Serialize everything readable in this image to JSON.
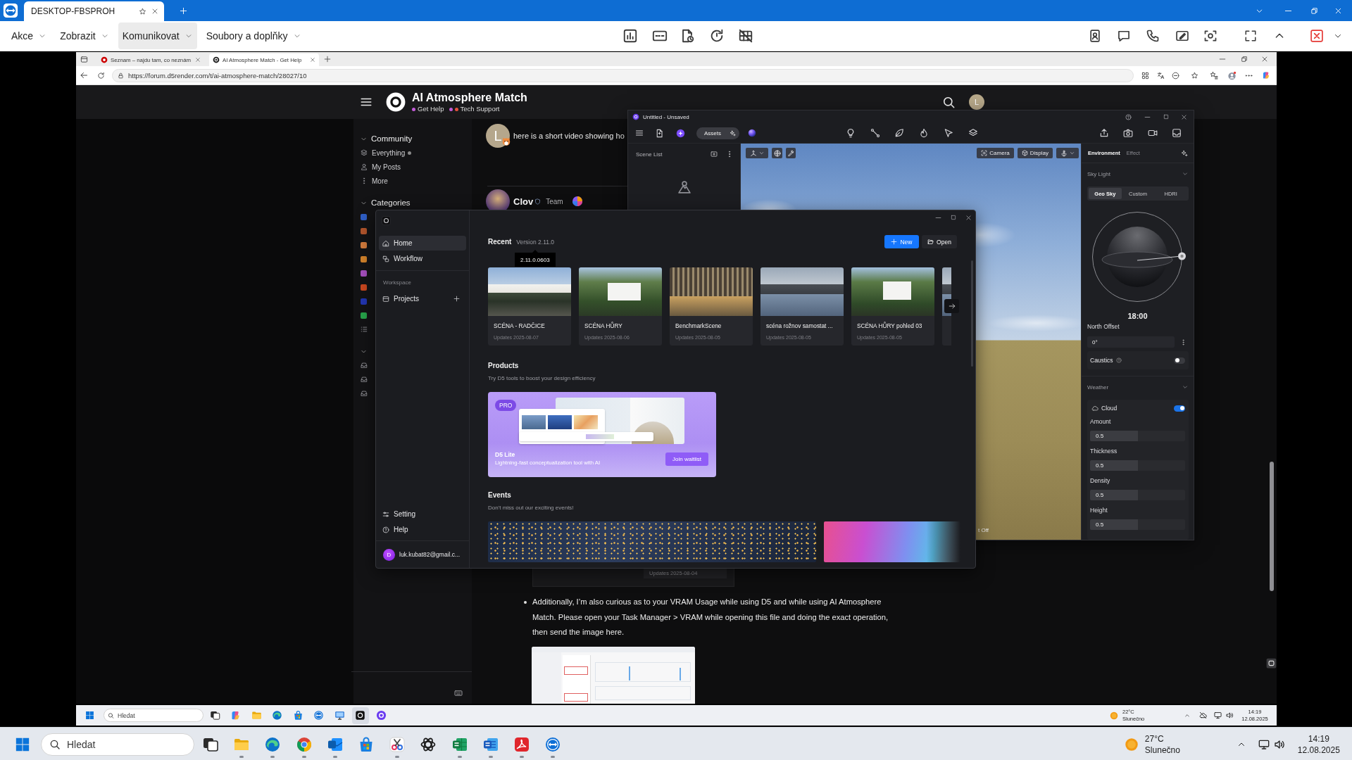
{
  "session": {
    "tab_title": "DESKTOP-FBSPROH",
    "menus": [
      {
        "label": "Akce",
        "selected": false
      },
      {
        "label": "Zobrazit",
        "selected": false
      },
      {
        "label": "Komunikovat",
        "selected": true
      },
      {
        "label": "Soubory a doplňky",
        "selected": false
      }
    ]
  },
  "browser": {
    "tabs": [
      {
        "title": "Seznam – najdu tam, co neznám",
        "selected": false
      },
      {
        "title": "AI Atmosphere Match - Get Help",
        "selected": true
      }
    ],
    "url": "https://forum.d5render.com/t/ai-atmosphere-match/28027/10"
  },
  "forum": {
    "title": "AI Atmosphere Match",
    "breadcrumb": [
      {
        "label": "Get Help",
        "color": "#c25cd8"
      },
      {
        "label": "Tech Support",
        "color": "#e5533d"
      }
    ],
    "user_initial": "L",
    "sidebar": [
      {
        "title": "Community",
        "expanded": true,
        "items": [
          {
            "kind": "layers",
            "label": "Everything",
            "unread": true
          },
          {
            "kind": "user",
            "label": "My Posts",
            "unread": false
          },
          {
            "kind": "more",
            "label": "More",
            "unread": false
          }
        ]
      },
      {
        "title": "Categories",
        "expanded": true,
        "items": [
          {
            "kind": "square",
            "color": "#2f5ec4"
          },
          {
            "kind": "square",
            "color": "#b0542c"
          },
          {
            "kind": "square",
            "color": "#d07a3c"
          },
          {
            "kind": "square",
            "color": "#d0812a"
          },
          {
            "kind": "square",
            "color": "#a54fbc"
          },
          {
            "kind": "square",
            "color": "#c9471f"
          },
          {
            "kind": "square",
            "color": "#2235b0"
          },
          {
            "kind": "square",
            "color": "#27a24a"
          },
          {
            "kind": "list"
          }
        ]
      },
      {
        "expanded": true,
        "items": [
          {
            "kind": "inbox"
          },
          {
            "kind": "inbox"
          },
          {
            "kind": "inbox"
          }
        ]
      }
    ],
    "posts": [
      {
        "kind": "message",
        "avatar_initial": "L",
        "text": "here is a short video showing ho"
      },
      {
        "kind": "author",
        "author": "Clov",
        "role": "Team"
      }
    ],
    "card_date": "Updates 2025-08-04",
    "bullet": "Additionally, I’m also curious as to your VRAM Usage while using D5 and while using AI Atmosphere Match. Please open your Task Manager > VRAM while opening this file and doing the exact operation, then send the image here."
  },
  "editor": {
    "title": "Untitled - Unsaved",
    "assets": "Assets",
    "scene_list": "Scene List",
    "view_buttons": [
      {
        "kind": "camera",
        "label": "Camera"
      },
      {
        "kind": "display",
        "label": "Display"
      }
    ],
    "view_status": "t Off",
    "panel": {
      "tabs": [
        {
          "label": "Environment",
          "selected": true
        },
        {
          "label": "Effect",
          "selected": false
        }
      ],
      "sky": {
        "title": "Sky Light",
        "expanded": true,
        "modes": [
          {
            "label": "Geo Sky",
            "selected": true
          },
          {
            "label": "Custom",
            "selected": false
          },
          {
            "label": "HDRI",
            "selected": false
          }
        ],
        "time": "18:00",
        "offset_label": "North Offset",
        "offset": "0°",
        "caustics": {
          "label": "Caustics",
          "on": false
        }
      },
      "weather": {
        "title": "Weather",
        "expanded": true,
        "cloud": {
          "label": "Cloud",
          "on": true
        },
        "sliders": [
          {
            "label": "Amount",
            "value": "0.5",
            "level": 0.5
          },
          {
            "label": "Thickness",
            "value": "0.5",
            "level": 0.5
          },
          {
            "label": "Density",
            "value": "0.5",
            "level": 0.5
          },
          {
            "label": "Height",
            "value": "0.5",
            "level": 0.5
          }
        ]
      }
    }
  },
  "launcher": {
    "nav": [
      {
        "kind": "home",
        "label": "Home",
        "selected": true
      },
      {
        "kind": "workflow",
        "label": "Workflow",
        "selected": false
      }
    ],
    "workspace": "Workspace",
    "projects": "Projects",
    "footer": [
      {
        "kind": "setting",
        "label": "Setting"
      },
      {
        "kind": "help",
        "label": "Help"
      }
    ],
    "user": {
      "initial": "D",
      "email": "luk.kubat82@gmail.c..."
    },
    "recent": {
      "title": "Recent",
      "version": "Version 2.11.0",
      "tooltip": "2.11.0.0603",
      "items": [
        {
          "name": "SCÉNA - RADČICE",
          "updated": "Updates 2025-08-07"
        },
        {
          "name": "SCÉNA HŮRY",
          "updated": "Updates 2025-08-06"
        },
        {
          "name": "BenchmarkScene",
          "updated": "Updates 2025-08-05"
        },
        {
          "name": "scéna rožnov samostat ...",
          "updated": "Updates 2025-08-05"
        },
        {
          "name": "SCÉNA HŮRY pohled 03",
          "updated": "Updates 2025-08-05"
        }
      ]
    },
    "actions": [
      {
        "kind": "primary",
        "label": "New"
      },
      {
        "kind": "secondary",
        "label": "Open"
      }
    ],
    "products": {
      "title": "Products",
      "subtitle": "Try D5 tools to boost your design efficiency",
      "badge": "PRO",
      "name": "D5 Lite",
      "tagline": "Lightning-fast conceptualization tool with AI",
      "button": "Join waitlist"
    },
    "events": {
      "title": "Events",
      "subtitle": "Don't miss out our exciting events!"
    }
  },
  "remote_taskbar": {
    "search": {
      "placeholder": "Hledat"
    },
    "apps": [
      {
        "kind": "taskview",
        "selected": false
      },
      {
        "kind": "petals",
        "selected": false
      },
      {
        "kind": "folder",
        "selected": false
      },
      {
        "kind": "wave",
        "selected": false
      },
      {
        "kind": "bag",
        "selected": false
      },
      {
        "kind": "remote",
        "selected": false
      },
      {
        "kind": "monitor",
        "selected": false
      },
      {
        "kind": "tile",
        "selected": true
      },
      {
        "kind": "orb",
        "selected": false
      }
    ],
    "weather": {
      "temp": "22°C",
      "text": "Slunečno"
    },
    "time": "14:19",
    "date": "12.08.2025"
  },
  "taskbar": {
    "search": {
      "placeholder": "Hledat"
    },
    "apps": [
      {
        "kind": "taskview",
        "running": false
      },
      {
        "kind": "folder",
        "running": true
      },
      {
        "kind": "wave",
        "running": true
      },
      {
        "kind": "wheel",
        "running": true
      },
      {
        "kind": "mail",
        "running": true
      },
      {
        "kind": "bag",
        "running": false
      },
      {
        "kind": "scissors",
        "running": true
      },
      {
        "kind": "knot",
        "running": false
      },
      {
        "kind": "sheet",
        "running": true
      },
      {
        "kind": "doc",
        "running": true
      },
      {
        "kind": "curl",
        "running": true
      },
      {
        "kind": "remote",
        "running": true
      }
    ],
    "weather": {
      "temp": "27°C",
      "text": "Slunečno"
    },
    "time": "14:19",
    "date": "12.08.2025"
  }
}
